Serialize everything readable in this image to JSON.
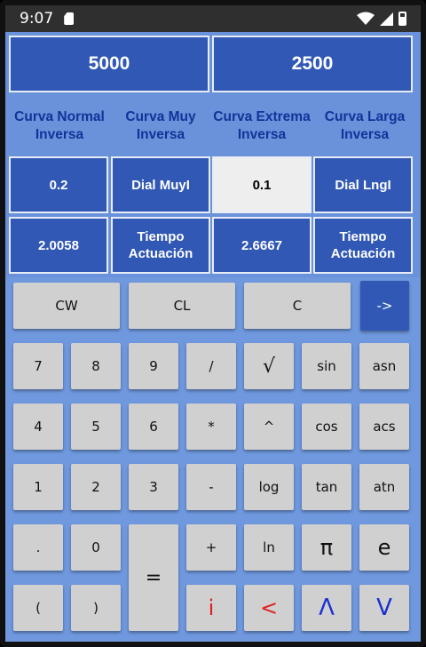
{
  "status": {
    "time": "9:07"
  },
  "display": {
    "value1": "5000",
    "value2": "2500"
  },
  "curves": [
    {
      "line1": "Curva Normal",
      "line2": "Inversa"
    },
    {
      "line1": "Curva Muy",
      "line2": "Inversa"
    },
    {
      "line1": "Curva Extrema",
      "line2": "Inversa"
    },
    {
      "line1": "Curva Larga",
      "line2": "Inversa"
    }
  ],
  "dials": [
    "0.2",
    "Dial MuyI",
    "0.1",
    "Dial LngI"
  ],
  "times": [
    {
      "value": "2.0058"
    },
    {
      "line1": "Tiempo",
      "line2": "Actuación"
    },
    {
      "value": "2.6667"
    },
    {
      "line1": "Tiempo",
      "line2": "Actuación"
    }
  ],
  "controls": {
    "cw": "CW",
    "cl": "CL",
    "c": "C",
    "arrow": "->"
  },
  "keys": {
    "k7": "7",
    "k8": "8",
    "k9": "9",
    "div": "/",
    "sqrt": "√",
    "sin": "sin",
    "asn": "asn",
    "k4": "4",
    "k5": "5",
    "k6": "6",
    "mul": "*",
    "pow": "^",
    "cos": "cos",
    "acs": "acs",
    "k1": "1",
    "k2": "2",
    "k3": "3",
    "sub": "-",
    "log": "log",
    "tan": "tan",
    "atn": "atn",
    "dot": ".",
    "k0": "0",
    "eq": "=",
    "add": "+",
    "ln": "ln",
    "pi": "π",
    "e": "e",
    "lparen": "(",
    "rparen": ")",
    "imag": "i",
    "lt": "<",
    "and": "Λ",
    "or": "V"
  }
}
